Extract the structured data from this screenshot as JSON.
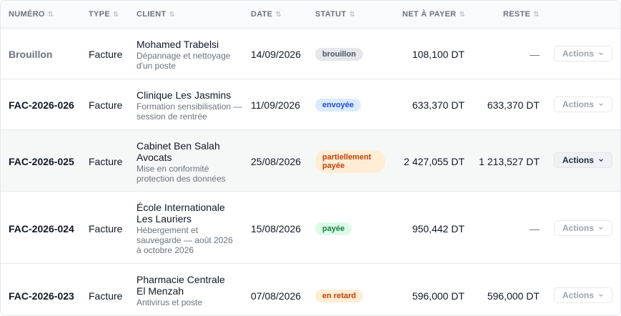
{
  "headers": {
    "numero": "NUMÉRO",
    "type": "TYPE",
    "client": "CLIENT",
    "date": "DATE",
    "statut": "STATUT",
    "net": "NET À PAYER",
    "reste": "RESTE",
    "sort_glyph": "⇅"
  },
  "rows": [
    {
      "numero": "Brouillon",
      "type": "Facture",
      "client_name": "Mohamed Trabelsi",
      "client_desc": "Dépannage et nettoyage d'un poste",
      "date": "14/09/2026",
      "statut": "brouillon",
      "net": "108,100 DT",
      "reste": "—",
      "action": "Actions"
    },
    {
      "numero": "FAC-2026-026",
      "type": "Facture",
      "client_name": "Clinique Les Jasmins",
      "client_desc": "Formation sensibilisation — session de rentrée",
      "date": "11/09/2026",
      "statut": "envoyée",
      "net": "633,370 DT",
      "reste": "633,370 DT",
      "action": "Actions"
    },
    {
      "numero": "FAC-2026-025",
      "type": "Facture",
      "client_name": "Cabinet Ben Salah Avocats",
      "client_desc": "Mise en conformité protection des données",
      "date": "25/08/2026",
      "statut": "partiellement payée",
      "net": "2 427,055 DT",
      "reste": "1 213,527 DT",
      "action": "Actions"
    },
    {
      "numero": "FAC-2026-024",
      "type": "Facture",
      "client_name": "École Internationale Les Lauriers",
      "client_desc": "Hébergement et sauvegarde — août 2026 à octobre 2026",
      "date": "15/08/2026",
      "statut": "payée",
      "net": "950,442 DT",
      "reste": "—",
      "action": "Actions"
    },
    {
      "numero": "FAC-2026-023",
      "type": "Facture",
      "client_name": "Pharmacie Centrale El Menzah",
      "client_desc": "Antivirus et poste",
      "date": "07/08/2026",
      "statut": "en retard",
      "net": "596,000 DT",
      "reste": "596,000 DT",
      "action": "Actions"
    }
  ]
}
